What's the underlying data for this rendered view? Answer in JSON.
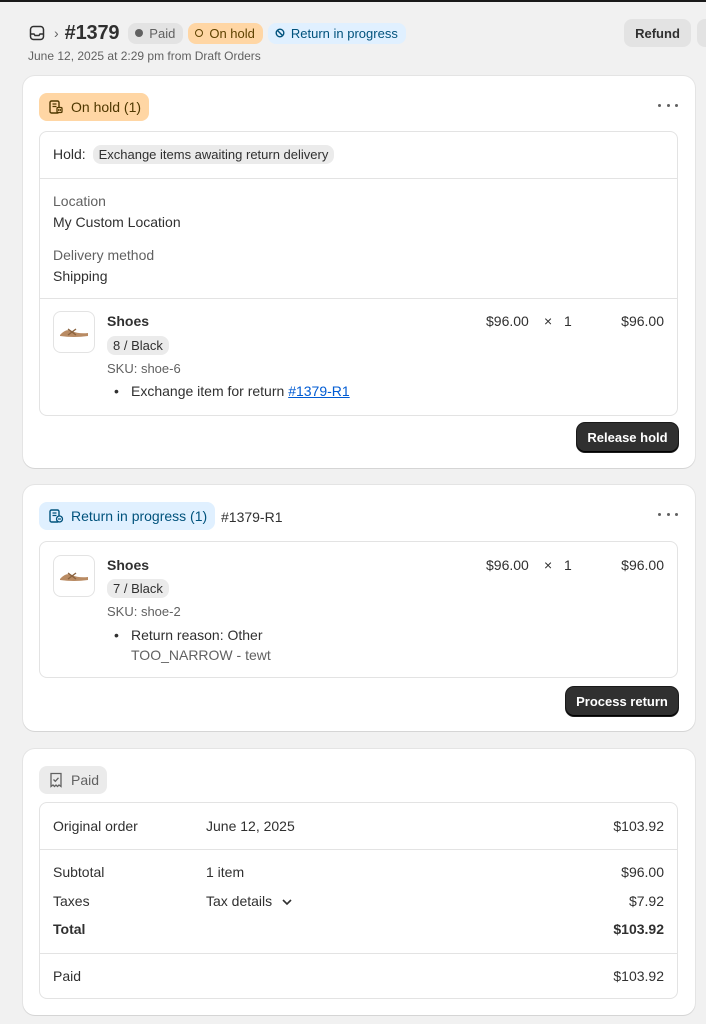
{
  "header": {
    "order_number": "#1379",
    "badges": {
      "paid": "Paid",
      "on_hold": "On hold",
      "return": "Return in progress"
    },
    "refund_label": "Refund",
    "subtitle": "June 12, 2025 at 2:29 pm from Draft Orders"
  },
  "hold_card": {
    "status": "On hold (1)",
    "hold_label": "Hold:",
    "hold_reason": "Exchange items awaiting return delivery",
    "location_label": "Location",
    "location_value": "My Custom Location",
    "delivery_label": "Delivery method",
    "delivery_value": "Shipping",
    "item": {
      "name": "Shoes",
      "variant": "8 / Black",
      "sku": "SKU: shoe-6",
      "note_prefix": "Exchange item for return ",
      "note_link": "#1379-R1",
      "unit_price": "$96.00",
      "times": "×",
      "quantity": "1",
      "total": "$96.00"
    },
    "action_label": "Release hold"
  },
  "return_card": {
    "status": "Return in progress (1)",
    "return_id": "#1379-R1",
    "item": {
      "name": "Shoes",
      "variant": "7 / Black",
      "sku": "SKU: shoe-2",
      "reason": "Return reason: Other",
      "reason_detail": "TOO_NARROW - tewt",
      "unit_price": "$96.00",
      "times": "×",
      "quantity": "1",
      "total": "$96.00"
    },
    "action_label": "Process return"
  },
  "payment_card": {
    "status": "Paid",
    "original_order_label": "Original order",
    "original_order_date": "June 12, 2025",
    "original_order_amount": "$103.92",
    "subtotal_label": "Subtotal",
    "subtotal_items": "1 item",
    "subtotal_amount": "$96.00",
    "taxes_label": "Taxes",
    "taxes_details": "Tax details",
    "taxes_amount": "$7.92",
    "total_label": "Total",
    "total_amount": "$103.92",
    "paid_label": "Paid",
    "paid_amount": "$103.92"
  },
  "colors": {
    "hold_bg": "#ffd6a4",
    "return_bg": "#e0f0ff",
    "link": "#005bd3",
    "primary_button": "#303030"
  },
  "icons": [
    "orders-icon",
    "chevron-right-icon",
    "on-hold-icon",
    "return-icon",
    "receipt-icon",
    "more-actions-icon",
    "shoe-thumbnail",
    "chevron-down-icon"
  ]
}
